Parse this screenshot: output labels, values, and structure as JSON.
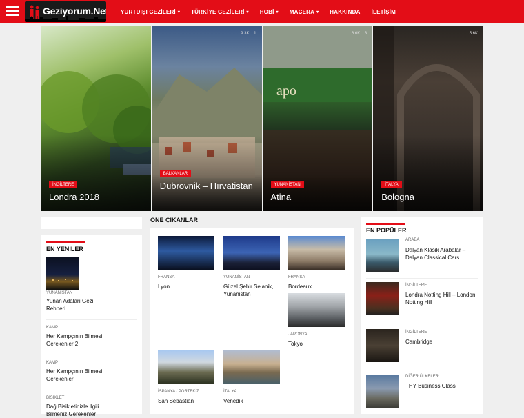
{
  "brand": {
    "name": "Geziyorum.Net"
  },
  "nav": {
    "items": [
      {
        "label": "YURTDIŞI GEZİLERİ",
        "dropdown": true
      },
      {
        "label": "TÜRKİYE GEZİLERİ",
        "dropdown": true
      },
      {
        "label": "HOBİ",
        "dropdown": true
      },
      {
        "label": "MACERA",
        "dropdown": true
      },
      {
        "label": "HAKKINDA",
        "dropdown": false
      },
      {
        "label": "İLETİŞİM",
        "dropdown": false
      }
    ]
  },
  "hero": [
    {
      "category": "İNGİLTERE",
      "title": "Londra 2018",
      "views": "",
      "comments": ""
    },
    {
      "category": "BALKANLAR",
      "title": "Dubrovnik – Hırvatistan",
      "views": "9.3K",
      "comments": "1"
    },
    {
      "category": "YUNANİSTAN",
      "title": "Atina",
      "views": "6.6K",
      "comments": "3"
    },
    {
      "category": "İTALYA",
      "title": "Bologna",
      "views": "5.6K",
      "comments": ""
    }
  ],
  "latest": {
    "title": "EN YENİLER",
    "items": [
      {
        "category": "YUNANİSTAN",
        "title": "Yunan Adaları Gezi Rehberi"
      },
      {
        "category": "KAMP",
        "title": "Her Kampçının Bilmesi Gerekenler 2"
      },
      {
        "category": "KAMP",
        "title": "Her Kampçının Bilmesi Gerekenler"
      },
      {
        "category": "BİSİKLET",
        "title": "Dağ Bisikletinizle İlgili Bilmeniz Gerekenler"
      }
    ]
  },
  "featured": {
    "title": "ÖNE ÇIKANLAR",
    "items": [
      {
        "category": "FRANSA",
        "title": "Lyon"
      },
      {
        "category": "YUNANİSTAN",
        "title": "Güzel Şehir Selanik, Yunanistan"
      },
      {
        "category": "FRANSA",
        "title": "Bordeaux"
      },
      {
        "category": "JAPONYA",
        "title": "Tokyo"
      },
      {
        "category": "İSPANYA / PORTEKİZ",
        "title": "San Sebastian"
      },
      {
        "category": "İTALYA",
        "title": "Venedik"
      }
    ]
  },
  "popular": {
    "title": "EN POPÜLER",
    "items": [
      {
        "category": "ARABA",
        "title": "Dalyan Klasik Arabalar – Dalyan Classical Cars"
      },
      {
        "category": "İNGİLTERE",
        "title": "Londra Notting Hill – London Notting Hill"
      },
      {
        "category": "İNGİLTERE",
        "title": "Cambridge"
      },
      {
        "category": "DİĞER ÜLKELER",
        "title": "THY Business Class"
      }
    ]
  }
}
